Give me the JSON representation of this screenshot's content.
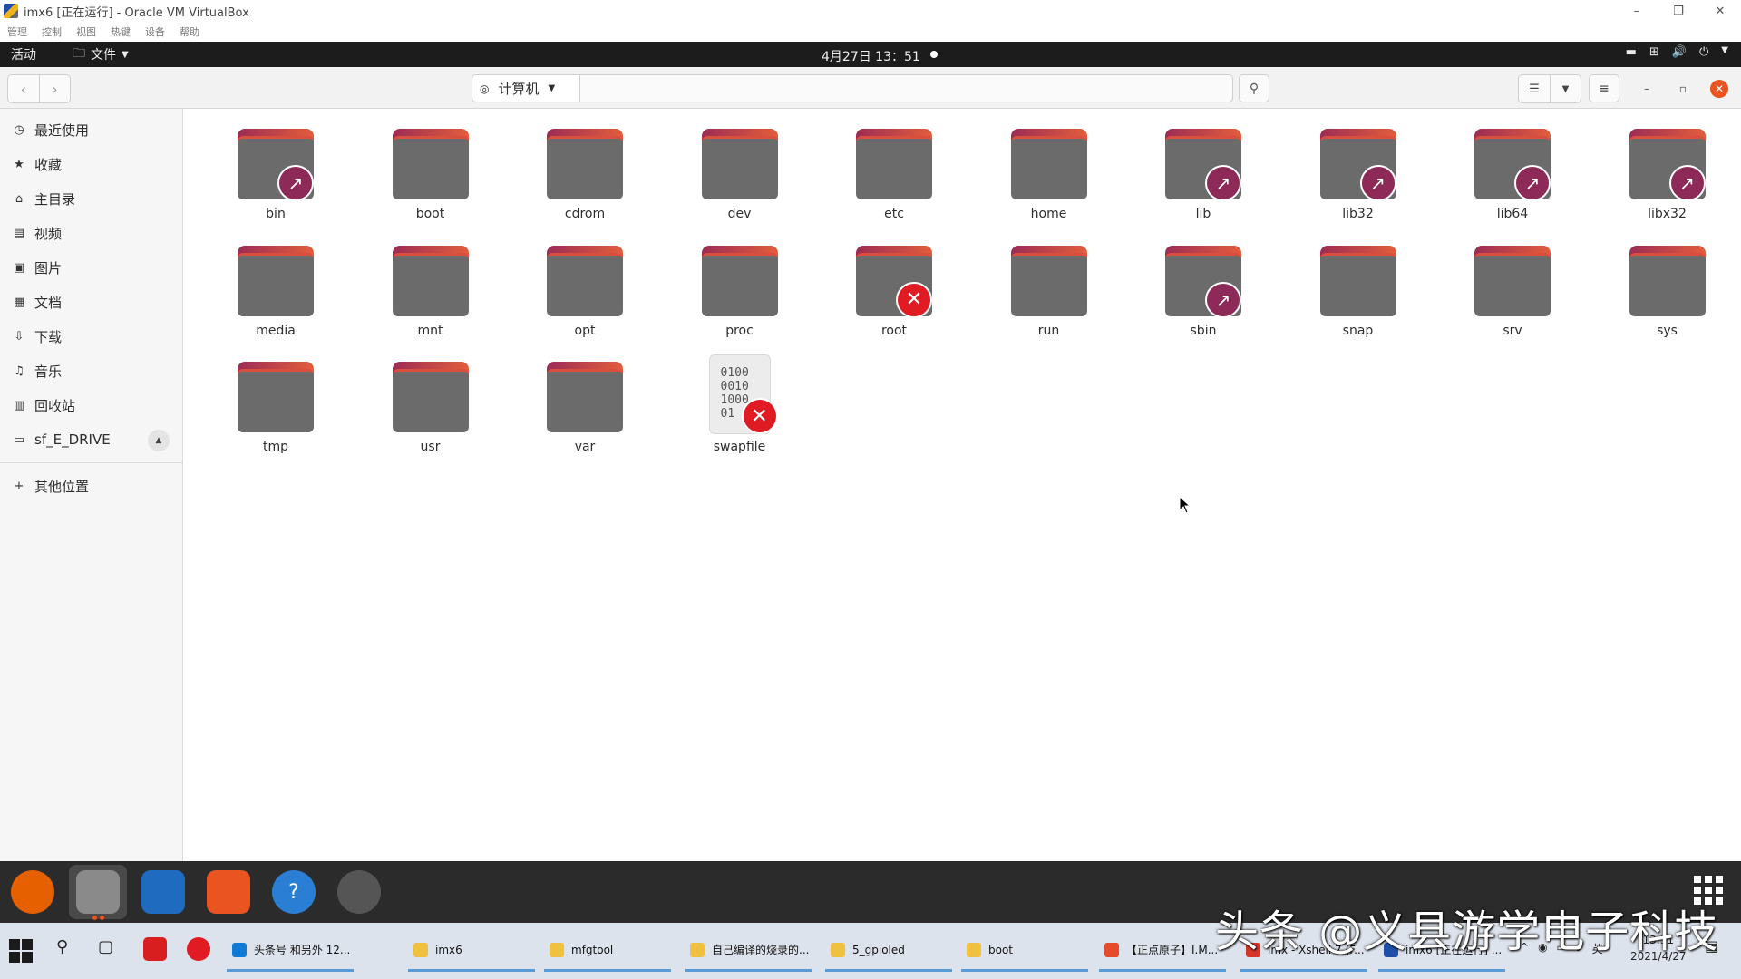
{
  "vbox": {
    "title": "imx6 [正在运行] - Oracle VM VirtualBox",
    "menu": [
      "管理",
      "控制",
      "视图",
      "热键",
      "设备",
      "帮助"
    ],
    "win_min": "–",
    "win_max": "❐",
    "win_close": "✕"
  },
  "topbar": {
    "activities": "活动",
    "app_menu": "文件",
    "clock": "4月27日  13：51"
  },
  "header": {
    "location": "计算机",
    "back": "‹",
    "forward": "›"
  },
  "sidebar": {
    "items": [
      {
        "label": "最近使用",
        "icon": "clock-icon",
        "glyph": "◷"
      },
      {
        "label": "收藏",
        "icon": "star-icon",
        "glyph": "★"
      },
      {
        "label": "主目录",
        "icon": "home-icon",
        "glyph": "⌂"
      },
      {
        "label": "视频",
        "icon": "film-icon",
        "glyph": "▤"
      },
      {
        "label": "图片",
        "icon": "image-icon",
        "glyph": "▣"
      },
      {
        "label": "文档",
        "icon": "document-icon",
        "glyph": "▦"
      },
      {
        "label": "下载",
        "icon": "download-icon",
        "glyph": "⇩"
      },
      {
        "label": "音乐",
        "icon": "music-icon",
        "glyph": "♫"
      },
      {
        "label": "回收站",
        "icon": "trash-icon",
        "glyph": "▥"
      },
      {
        "label": "sf_E_DRIVE",
        "icon": "drive-icon",
        "glyph": "▭"
      }
    ],
    "other": {
      "label": "其他位置",
      "glyph": "+"
    }
  },
  "files": {
    "items": [
      {
        "name": "bin",
        "kind": "folder",
        "emblem": "link"
      },
      {
        "name": "boot",
        "kind": "folder",
        "emblem": ""
      },
      {
        "name": "cdrom",
        "kind": "folder",
        "emblem": ""
      },
      {
        "name": "dev",
        "kind": "folder",
        "emblem": ""
      },
      {
        "name": "etc",
        "kind": "folder",
        "emblem": ""
      },
      {
        "name": "home",
        "kind": "folder",
        "emblem": ""
      },
      {
        "name": "lib",
        "kind": "folder",
        "emblem": "link"
      },
      {
        "name": "lib32",
        "kind": "folder",
        "emblem": "link"
      },
      {
        "name": "lib64",
        "kind": "folder",
        "emblem": "link"
      },
      {
        "name": "libx32",
        "kind": "folder",
        "emblem": "link"
      },
      {
        "name": "media",
        "kind": "folder",
        "emblem": ""
      },
      {
        "name": "mnt",
        "kind": "folder",
        "emblem": ""
      },
      {
        "name": "opt",
        "kind": "folder",
        "emblem": ""
      },
      {
        "name": "proc",
        "kind": "folder",
        "emblem": ""
      },
      {
        "name": "root",
        "kind": "folder",
        "emblem": "unreadable"
      },
      {
        "name": "run",
        "kind": "folder",
        "emblem": ""
      },
      {
        "name": "sbin",
        "kind": "folder",
        "emblem": "link"
      },
      {
        "name": "snap",
        "kind": "folder",
        "emblem": ""
      },
      {
        "name": "srv",
        "kind": "folder",
        "emblem": ""
      },
      {
        "name": "sys",
        "kind": "folder",
        "emblem": ""
      },
      {
        "name": "tmp",
        "kind": "folder",
        "emblem": ""
      },
      {
        "name": "usr",
        "kind": "folder",
        "emblem": ""
      },
      {
        "name": "var",
        "kind": "folder",
        "emblem": ""
      },
      {
        "name": "swapfile",
        "kind": "binary",
        "emblem": "unreadable"
      }
    ],
    "binary_glyph": [
      "0100",
      "0010",
      "1000",
      "01"
    ]
  },
  "dock": {
    "apps": [
      {
        "name": "firefox-icon",
        "color": "#e66000"
      },
      {
        "name": "files-icon",
        "color": "#8a8a8a"
      },
      {
        "name": "writer-icon",
        "color": "#1f6bbf"
      },
      {
        "name": "software-icon",
        "color": "#e95420"
      },
      {
        "name": "help-icon",
        "color": "#2a7fd4"
      },
      {
        "name": "updater-icon",
        "color": "#555555"
      }
    ],
    "help_glyph": "?"
  },
  "taskbar": {
    "apps": [
      {
        "label": "头条号 和另外 12...",
        "color": "#0f7ad6"
      },
      {
        "label": "imx6",
        "color": "#f0c040"
      },
      {
        "label": "mfgtool",
        "color": "#f0c040"
      },
      {
        "label": "自己编译的烧录的...",
        "color": "#f0c040"
      },
      {
        "label": "5_gpioled",
        "color": "#f0c040"
      },
      {
        "label": "boot",
        "color": "#f0c040"
      },
      {
        "label": "【正点原子】I.M...",
        "color": "#e54b2a"
      },
      {
        "label": "imx - Xshell 7 (F...",
        "color": "#d8352a"
      },
      {
        "label": "imx6 [正在运行] ...",
        "color": "#1f4fa8"
      }
    ],
    "ime": "英",
    "time": "13:51",
    "date": "2021/4/27"
  },
  "watermark": "头条 @义县游学电子科技"
}
